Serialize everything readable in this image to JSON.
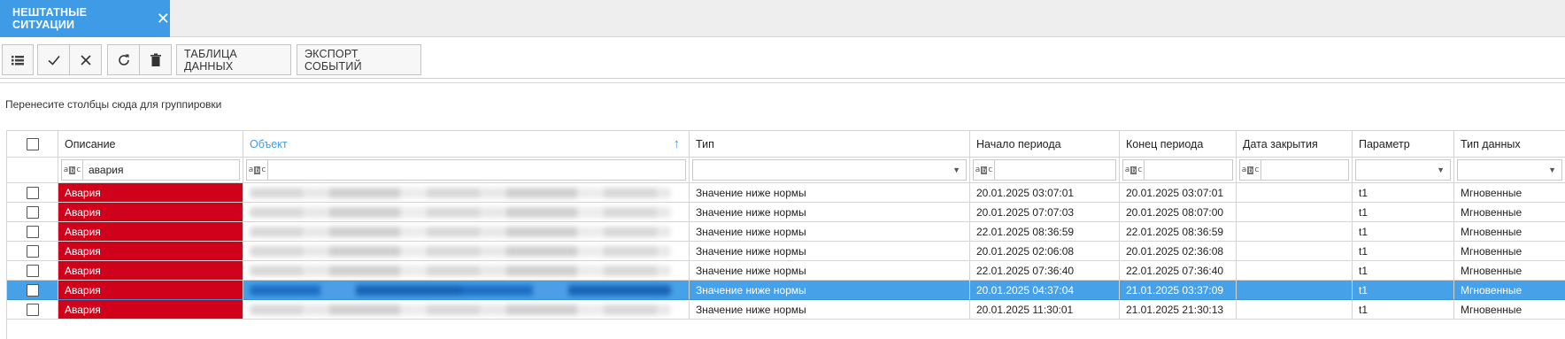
{
  "tab": {
    "label": "НЕШТАТНЫЕ СИТУАЦИИ"
  },
  "toolbar": {
    "data_table_label": "ТАБЛИЦА ДАННЫХ",
    "export_label": "ЭКСПОРТ СОБЫТИЙ",
    "icons": [
      "list-icon",
      "check-icon",
      "close-icon",
      "refresh-icon",
      "trash-icon"
    ]
  },
  "group_hint": "Перенесите столбцы сюда для группировки",
  "columns": {
    "description": "Описание",
    "object": "Объект",
    "type": "Тип",
    "start": "Начало периода",
    "end": "Конец периода",
    "closed": "Дата закрытия",
    "param": "Параметр",
    "datatype": "Тип данных"
  },
  "filter": {
    "description": "авария"
  },
  "colors": {
    "accent": "#3f9be6",
    "alarm": "#d0021b",
    "selected_row": "#46a1e9"
  },
  "rows": [
    {
      "description": "Авария",
      "type": "Значение ниже нормы",
      "start": "20.01.2025 03:07:01",
      "end": "20.01.2025 03:07:01",
      "closed": "",
      "param": "t1",
      "datatype": "Мгновенные"
    },
    {
      "description": "Авария",
      "type": "Значение ниже нормы",
      "start": "20.01.2025 07:07:03",
      "end": "20.01.2025 08:07:00",
      "closed": "",
      "param": "t1",
      "datatype": "Мгновенные"
    },
    {
      "description": "Авария",
      "type": "Значение ниже нормы",
      "start": "22.01.2025 08:36:59",
      "end": "22.01.2025 08:36:59",
      "closed": "",
      "param": "t1",
      "datatype": "Мгновенные"
    },
    {
      "description": "Авария",
      "type": "Значение ниже нормы",
      "start": "20.01.2025 02:06:08",
      "end": "20.01.2025 02:36:08",
      "closed": "",
      "param": "t1",
      "datatype": "Мгновенные"
    },
    {
      "description": "Авария",
      "type": "Значение ниже нормы",
      "start": "22.01.2025 07:36:40",
      "end": "22.01.2025 07:36:40",
      "closed": "",
      "param": "t1",
      "datatype": "Мгновенные"
    },
    {
      "description": "Авария",
      "type": "Значение ниже нормы",
      "start": "20.01.2025 04:37:04",
      "end": "21.01.2025 03:37:09",
      "closed": "",
      "param": "t1",
      "datatype": "Мгновенные"
    },
    {
      "description": "Авария",
      "type": "Значение ниже нормы",
      "start": "20.01.2025 11:30:01",
      "end": "21.01.2025 21:30:13",
      "closed": "",
      "param": "t1",
      "datatype": "Мгновенные"
    }
  ]
}
